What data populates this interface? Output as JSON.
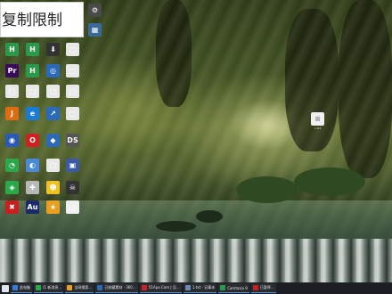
{
  "overlay": {
    "copy_limit_text": "复制限制"
  },
  "desktop_icons": [
    {
      "name": "desktop-icon-1",
      "glyph": "⚙",
      "color": "#4a4a4a",
      "label": ""
    },
    {
      "name": "desktop-icon-2",
      "glyph": "▦",
      "color": "#3a6a9a",
      "label": ""
    },
    {
      "name": "desktop-icon-3",
      "glyph": "H",
      "color": "#2a9a4a",
      "label": ""
    },
    {
      "name": "desktop-icon-4",
      "glyph": "H",
      "color": "#2a9a4a",
      "label": ""
    },
    {
      "name": "desktop-icon-5",
      "glyph": "⬇",
      "color": "#333333",
      "label": ""
    },
    {
      "name": "desktop-icon-6",
      "glyph": "□",
      "color": "#e8e8e8",
      "label": ""
    },
    {
      "name": "desktop-icon-7",
      "glyph": "Pr",
      "color": "#3a0a5a",
      "label": ""
    },
    {
      "name": "desktop-icon-8",
      "glyph": "H",
      "color": "#2a9a4a",
      "label": ""
    },
    {
      "name": "desktop-icon-9",
      "glyph": "◎",
      "color": "#2a6ab8",
      "label": ""
    },
    {
      "name": "desktop-icon-10",
      "glyph": "□",
      "color": "#e8e8e8",
      "label": ""
    },
    {
      "name": "desktop-icon-11",
      "glyph": "□",
      "color": "#e8e8e8",
      "label": ""
    },
    {
      "name": "desktop-icon-12",
      "glyph": "□",
      "color": "#e8e8e8",
      "label": ""
    },
    {
      "name": "desktop-icon-13",
      "glyph": "□",
      "color": "#e8e8e8",
      "label": ""
    },
    {
      "name": "desktop-icon-14",
      "glyph": "□",
      "color": "#e8e8e8",
      "label": ""
    },
    {
      "name": "desktop-icon-15",
      "glyph": "J",
      "color": "#e06a10",
      "label": ""
    },
    {
      "name": "desktop-icon-16",
      "glyph": "e",
      "color": "#1a7ad8",
      "label": ""
    },
    {
      "name": "desktop-icon-17",
      "glyph": "↗",
      "color": "#2a6ab8",
      "label": ""
    },
    {
      "name": "desktop-icon-18",
      "glyph": "□",
      "color": "#e8e8e8",
      "label": ""
    },
    {
      "name": "desktop-icon-19",
      "glyph": "◉",
      "color": "#2a5ab8",
      "label": ""
    },
    {
      "name": "desktop-icon-20",
      "glyph": "O",
      "color": "#d02020",
      "label": ""
    },
    {
      "name": "desktop-icon-21",
      "glyph": "◆",
      "color": "#2a6ab8",
      "label": ""
    },
    {
      "name": "desktop-icon-22",
      "glyph": "DS",
      "color": "#555555",
      "label": ""
    },
    {
      "name": "desktop-icon-23",
      "glyph": "◔",
      "color": "#2aa84a",
      "label": ""
    },
    {
      "name": "desktop-icon-24",
      "glyph": "◐",
      "color": "#4a8ad8",
      "label": ""
    },
    {
      "name": "desktop-icon-25",
      "glyph": "□",
      "color": "#e8e8e8",
      "label": ""
    },
    {
      "name": "desktop-icon-26",
      "glyph": "▣",
      "color": "#3a5aa8",
      "label": ""
    },
    {
      "name": "desktop-icon-27",
      "glyph": "◈",
      "color": "#2aa84a",
      "label": ""
    },
    {
      "name": "desktop-icon-28",
      "glyph": "✚",
      "color": "#b8b8b8",
      "label": ""
    },
    {
      "name": "desktop-icon-29",
      "glyph": "☻",
      "color": "#f0c020",
      "label": ""
    },
    {
      "name": "desktop-icon-30",
      "glyph": "☠",
      "color": "#333333",
      "label": ""
    },
    {
      "name": "desktop-icon-31",
      "glyph": "✖",
      "color": "#c82020",
      "label": ""
    },
    {
      "name": "desktop-icon-32",
      "glyph": "Au",
      "color": "#1a2a6a",
      "label": ""
    },
    {
      "name": "desktop-icon-33",
      "glyph": "★",
      "color": "#e8a020",
      "label": ""
    },
    {
      "name": "desktop-icon-34",
      "glyph": "□",
      "color": "#f0f0f0",
      "label": ""
    }
  ],
  "taskbar": {
    "items": [
      {
        "name": "taskbar-item-1",
        "label": "此电脑",
        "color": "#3a7ad8"
      },
      {
        "name": "taskbar-item-2",
        "label": "(1 新消息…",
        "color": "#2aa84a"
      },
      {
        "name": "taskbar-item-3",
        "label": "全网搜索…",
        "color": "#e8a020"
      },
      {
        "name": "taskbar-item-4",
        "label": "已收藏素材 · 360…",
        "color": "#2a6ab8"
      },
      {
        "name": "taskbar-item-5",
        "label": "51Apx.Com | 见…",
        "color": "#d02020"
      },
      {
        "name": "taskbar-item-6",
        "label": "1.txt - 记事本",
        "color": "#6a8ab8"
      },
      {
        "name": "taskbar-item-7",
        "label": "Camtasia 9",
        "color": "#2a9a4a"
      },
      {
        "name": "taskbar-item-8",
        "label": "已暂停…",
        "color": "#c82020"
      }
    ]
  },
  "desktop_file": {
    "label": "1.txt"
  }
}
